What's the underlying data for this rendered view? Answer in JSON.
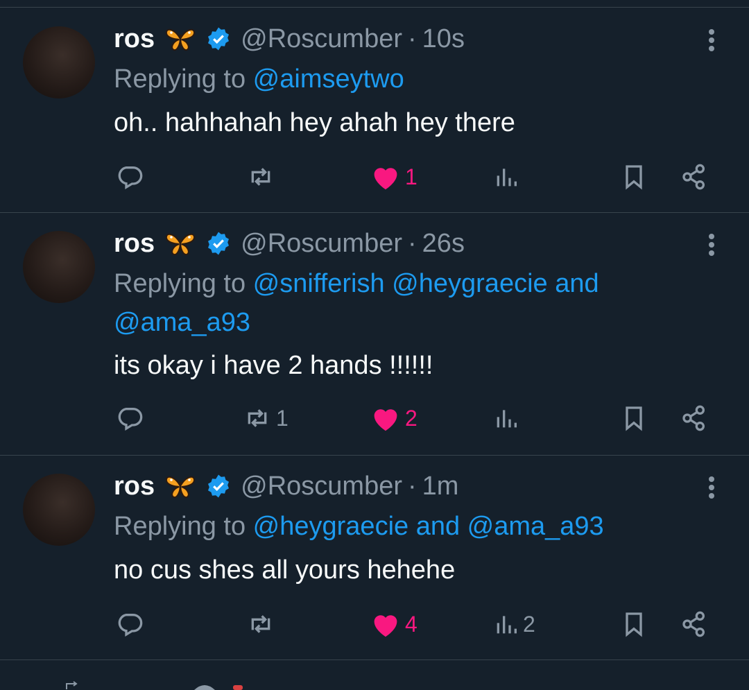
{
  "tweets": [
    {
      "name": "ros",
      "handle": "@Roscumber",
      "time": "10s",
      "replying_prefix": "Replying to ",
      "replying_mentions": "@aimseytwo",
      "text": "oh.. hahhahah hey ahah hey there",
      "retweets": "",
      "likes": "1",
      "views": ""
    },
    {
      "name": "ros",
      "handle": "@Roscumber",
      "time": "26s",
      "replying_prefix": "Replying to ",
      "replying_mentions": "@snifferish @heygraecie and @ama_a93",
      "text": "its okay i have 2 hands !!!!!!",
      "retweets": "1",
      "likes": "2",
      "views": ""
    },
    {
      "name": "ros",
      "handle": "@Roscumber",
      "time": "1m",
      "replying_prefix": "Replying to ",
      "replying_mentions": "@heygraecie and @ama_a93",
      "text": "no cus shes all yours hehehe",
      "retweets": "",
      "likes": "4",
      "views": "2"
    }
  ],
  "separator": "·",
  "colors": {
    "background": "#15202b",
    "border": "#38444d",
    "muted": "#8b98a5",
    "accent": "#1d9bf0",
    "like": "#f91880"
  },
  "icons": [
    "butterfly-emoji-icon",
    "verified-badge-icon",
    "more-icon",
    "reply-icon",
    "retweet-icon",
    "like-icon",
    "views-icon",
    "bookmark-icon",
    "share-icon"
  ]
}
